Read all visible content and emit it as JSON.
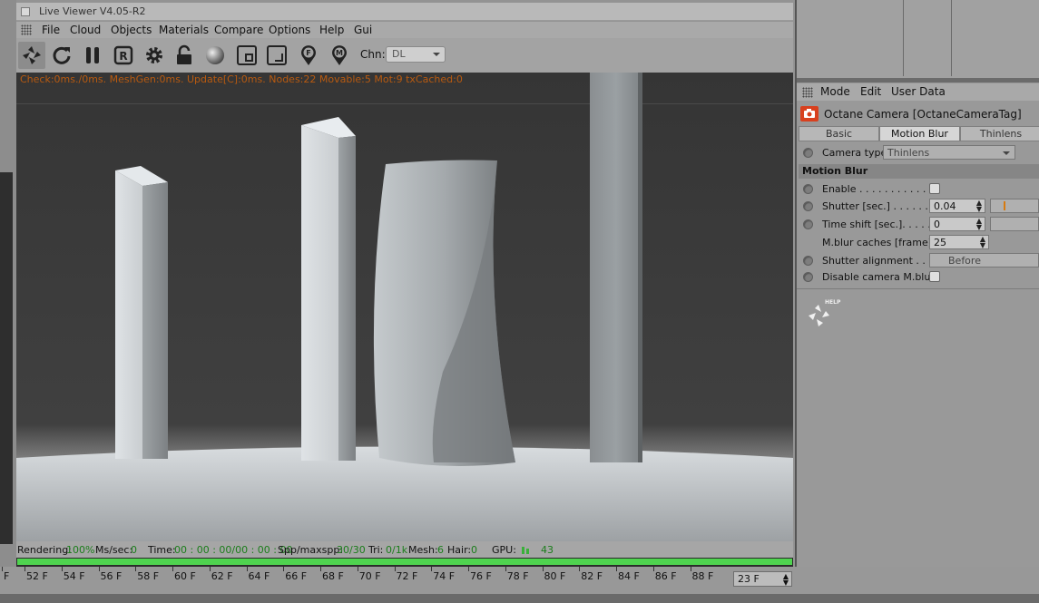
{
  "window": {
    "title": "Live Viewer V4.05-R2"
  },
  "menu": [
    "File",
    "Cloud",
    "Objects",
    "Materials",
    "Compare",
    "Options",
    "Help",
    "Gui"
  ],
  "toolbar": {
    "icons": [
      "octane-logo-icon",
      "restart-icon",
      "pause-icon",
      "region-render-icon",
      "settings-gear-icon",
      "lock-icon",
      "material-ball-icon",
      "render-region-icon",
      "clay-mode-icon",
      "focus-pick-icon",
      "material-pick-icon"
    ],
    "channel_label": "Chn:",
    "channel_value": "DL"
  },
  "viewport": {
    "stats": "Check:0ms./0ms. MeshGen:0ms. Update[C]:0ms. Nodes:22 Movable:5 Mot:9 txCached:0"
  },
  "status": {
    "rendering_label": "Rendering:",
    "rendering_value": "100%",
    "mssec_label": "Ms/sec:",
    "mssec_value": "0",
    "time_label": "Time:",
    "time_value": "00 : 00 : 00/00 : 00 : 00",
    "spp_label": "Spp/maxspp:",
    "spp_value": "30/30",
    "tri_label": "Tri:",
    "tri_value": "0/1k",
    "mesh_label": "Mesh:",
    "mesh_value": "6",
    "hair_label": "Hair:",
    "hair_value": "0",
    "gpu_label": "GPU:",
    "gpu_value": "43",
    "progress": 1.0
  },
  "timeline": {
    "ticks": [
      "F",
      "52 F",
      "54 F",
      "56 F",
      "58 F",
      "60 F",
      "62 F",
      "64 F",
      "66 F",
      "68 F",
      "70 F",
      "72 F",
      "74 F",
      "76 F",
      "78 F",
      "80 F",
      "82 F",
      "84 F",
      "86 F",
      "88 F"
    ],
    "current_frame": "23 F"
  },
  "attributes": {
    "menu": [
      "Mode",
      "Edit",
      "User Data"
    ],
    "object_title": "Octane Camera [OctaneCameraTag]",
    "tabs": [
      {
        "label": "Basic",
        "active": false
      },
      {
        "label": "Motion Blur",
        "active": true
      },
      {
        "label": "Thinlens",
        "active": false
      }
    ],
    "camera_type_label": "Camera type",
    "camera_type_value": "Thinlens",
    "section": "Motion Blur",
    "enable_label": "Enable . . . . . . . . . . . . .",
    "enable_checked": false,
    "shutter_label": "Shutter [sec.] . . . . . . .",
    "shutter_value": "0.04",
    "shutter_fraction": 0.04,
    "timeshift_label": "Time shift [sec.]. . . . .",
    "timeshift_value": "0",
    "caches_label": "M.blur caches [frame]",
    "caches_value": "25",
    "alignment_label": "Shutter alignment . . .",
    "alignment_value": "Before",
    "disable_label": "Disable camera M.blur",
    "disable_checked": false,
    "help_label": "HELP"
  },
  "colors": {
    "stats_text": "#b85a10",
    "status_value": "#1b7d1b",
    "progress_fill": "#4fd34f",
    "camera_icon": "#d8401e"
  }
}
